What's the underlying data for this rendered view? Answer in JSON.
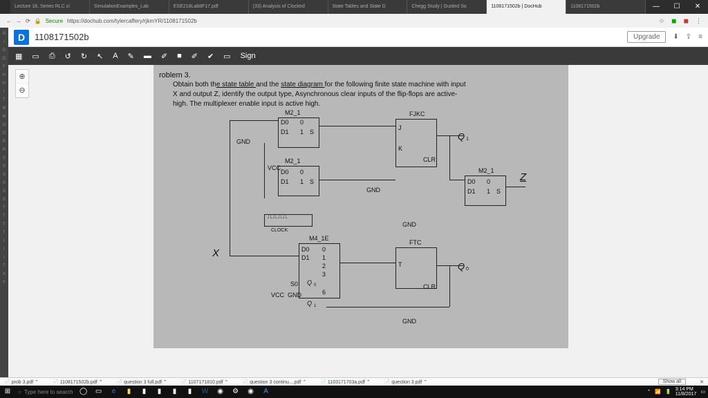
{
  "window": {
    "min": "—",
    "max": "☐",
    "close": "✕"
  },
  "tabs": [
    "Lecture 18, Series RLC ci",
    "SimulationExamples_Lab",
    "ESE218Lab8F17.pdf",
    "(33) Analysis of Clocked",
    "State Tables and State D",
    "Chegg Study | Guided So",
    "1108171502b | DocHub",
    "1108171502b"
  ],
  "url": {
    "secure": "Secure",
    "text": "https://dochub.com/tylercaffery/rjkmYR/1108171502b",
    "back": "←",
    "fwd": "→",
    "reload": "⟳",
    "lock": "🔒",
    "star": "☆"
  },
  "dochub": {
    "logo": "D",
    "title": "1108171502b",
    "upgrade": "Upgrade"
  },
  "toolbar": {
    "grid": "▦",
    "page": "▭",
    "print": "⎙",
    "undo": "↺",
    "redo": "↻",
    "pointer": "↖",
    "text": "A",
    "pen": "✎",
    "highlight": "▬",
    "marker": "✐",
    "stamp": "■",
    "eraser": "✐",
    "check": "✔",
    "img": "▭",
    "sign": "Sign"
  },
  "zoom": {
    "in": "⊕",
    "out": "⊖"
  },
  "problem": {
    "title": "roblem 3.",
    "l1a": "Obtain both th",
    "l1b": "e state table ",
    "l1c": "and the ",
    "l1d": "state diagram ",
    "l1e": "for the following finite state machine with input",
    "l2": "X and output Z, identify the output type, Asynchronous clear inputs of the flip-flops are active-",
    "l3": "high. The multiplexer enable input is active high."
  },
  "labels": {
    "m2_1": "M2_1",
    "fjkc": "FJKC",
    "ftc": "FTC",
    "m4_1e": "M4_1E",
    "q1": "Q",
    "q0": "Q",
    "z": "Z",
    "x": "X",
    "gnd": "GND",
    "vcc": "VCC",
    "clr": "CLR",
    "d0": "D0",
    "d1": "D1",
    "s": "S",
    "j": "J",
    "k": "K",
    "t": "T",
    "clock": "CLOCK",
    "s0": "S0",
    "zero": "0",
    "one": "1",
    "two": "2",
    "three": "3",
    "six": "6",
    "sub0": "0",
    "sub1": "1"
  },
  "downloads": [
    "prob 3.pdf",
    "1108171502b.pdf",
    "question 3 full.pdf",
    "1107171810.pdf",
    "question 3 continu....pdf",
    "1103171703a.pdf",
    "question 3.pdf"
  ],
  "showall": "Show all",
  "taskbar": {
    "search": "Type here to search",
    "time": "3:14 PM",
    "date": "11/8/2017"
  }
}
